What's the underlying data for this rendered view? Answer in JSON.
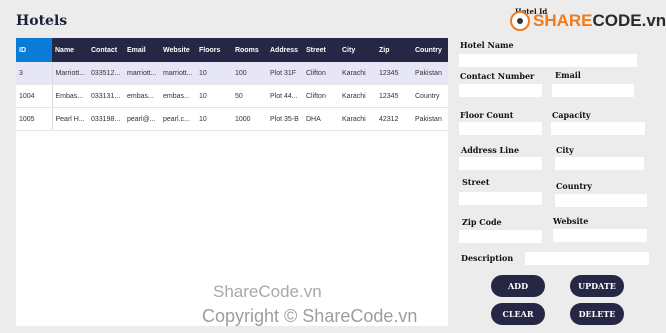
{
  "page": {
    "title": "Hotels"
  },
  "branding": {
    "logo_part1": "SHARE",
    "logo_part2": "CODE.vn",
    "accent_color": "#f07b1e"
  },
  "watermark": {
    "line1": "ShareCode.vn",
    "line2": "Copyright © ShareCode.vn"
  },
  "table": {
    "columns": [
      "ID",
      "Name",
      "Contact",
      "Email",
      "Website",
      "Floors",
      "Rooms",
      "Address",
      "Street",
      "City",
      "Zip",
      "Country"
    ],
    "rows": [
      [
        "3",
        "Marriott...",
        "033512...",
        "marriott...",
        "marriott...",
        "10",
        "100",
        "Plot 31F",
        "Clifton",
        "Karachi",
        "12345",
        "Pakistan"
      ],
      [
        "1004",
        "Embas...",
        "033131...",
        "embas...",
        "embas...",
        "10",
        "50",
        "Plot 44...",
        "Clifton",
        "Karachi",
        "12345",
        "Country"
      ],
      [
        "1005",
        "Pearl H...",
        "033198...",
        "pearl@...",
        "pearl.c...",
        "10",
        "1000",
        "Plot 35-B",
        "DHA",
        "Karachi",
        "42312",
        "Pakistan"
      ]
    ]
  },
  "form": {
    "hotel_id": "Hotel Id",
    "hotel_name": "Hotel Name",
    "contact_number": "Contact Number",
    "email": "Email",
    "floor_count": "Floor Count",
    "capacity": "Capacity",
    "address_line": "Address Line",
    "city": "City",
    "street": "Street",
    "country": "Country",
    "zip_code": "Zip Code",
    "website": "Website",
    "description": "Description"
  },
  "buttons": {
    "add": "ADD",
    "update": "UPDATE",
    "clear": "CLEAR",
    "delete": "DELETE"
  }
}
